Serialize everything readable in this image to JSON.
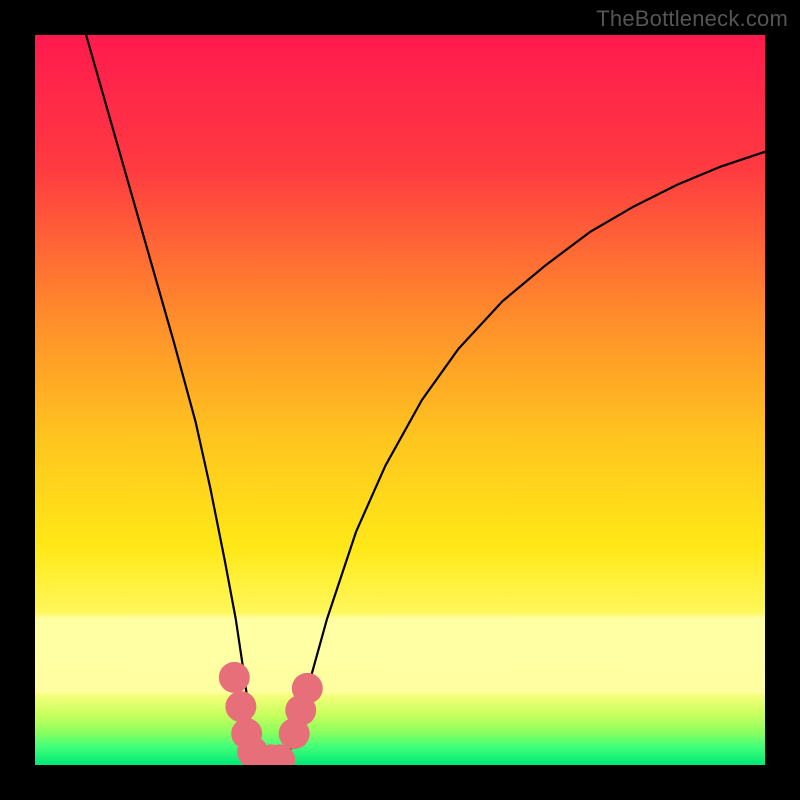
{
  "watermark": {
    "text": "TheBottleneck.com"
  },
  "chart_data": {
    "type": "line",
    "title": "",
    "xlabel": "",
    "ylabel": "",
    "xlim": [
      0,
      100
    ],
    "ylim": [
      0,
      100
    ],
    "grid": false,
    "legend": false,
    "background_gradient": {
      "stops": [
        {
          "pos": 0.0,
          "color": "#ff1a4e"
        },
        {
          "pos": 0.18,
          "color": "#ff3a41"
        },
        {
          "pos": 0.38,
          "color": "#ff8a2c"
        },
        {
          "pos": 0.55,
          "color": "#ffc41f"
        },
        {
          "pos": 0.7,
          "color": "#ffe817"
        },
        {
          "pos": 0.79,
          "color": "#fff75a"
        },
        {
          "pos": 0.8,
          "color": "#ffffa4"
        },
        {
          "pos": 0.9,
          "color": "#ffffa2"
        },
        {
          "pos": 0.905,
          "color": "#f3ff7a"
        },
        {
          "pos": 0.93,
          "color": "#caff5e"
        },
        {
          "pos": 0.955,
          "color": "#8cff5f"
        },
        {
          "pos": 0.975,
          "color": "#42ff79"
        },
        {
          "pos": 1.0,
          "color": "#00e876"
        }
      ]
    },
    "series": [
      {
        "name": "bottleneck-curve",
        "color": "#000000",
        "x": [
          7.0,
          10.0,
          13.0,
          16.0,
          19.0,
          22.0,
          24.0,
          26.0,
          27.5,
          28.7,
          29.6,
          30.3,
          32.5,
          34.5,
          35.8,
          37.5,
          40.0,
          44.0,
          48.0,
          53.0,
          58.0,
          64.0,
          70.0,
          76.0,
          82.0,
          88.0,
          94.0,
          100.0
        ],
        "y": [
          100.0,
          89.5,
          79.0,
          68.5,
          58.0,
          47.0,
          38.0,
          28.0,
          20.0,
          12.0,
          5.0,
          0.5,
          0.5,
          0.5,
          5.0,
          11.0,
          20.0,
          32.0,
          41.0,
          50.0,
          57.0,
          63.5,
          68.5,
          73.0,
          76.5,
          79.5,
          82.0,
          84.0
        ]
      }
    ],
    "markers": [
      {
        "x": 27.3,
        "y": 12.0,
        "color": "#e76f7a",
        "r": 1.3
      },
      {
        "x": 28.2,
        "y": 8.0,
        "color": "#e76f7a",
        "r": 1.3
      },
      {
        "x": 29.0,
        "y": 4.3,
        "color": "#e76f7a",
        "r": 1.3
      },
      {
        "x": 29.8,
        "y": 1.8,
        "color": "#e76f7a",
        "r": 1.3
      },
      {
        "x": 31.0,
        "y": 0.7,
        "color": "#e76f7a",
        "r": 1.3
      },
      {
        "x": 32.3,
        "y": 0.7,
        "color": "#e76f7a",
        "r": 1.3
      },
      {
        "x": 33.5,
        "y": 0.7,
        "color": "#e76f7a",
        "r": 1.3
      },
      {
        "x": 35.5,
        "y": 4.3,
        "color": "#e76f7a",
        "r": 1.3
      },
      {
        "x": 36.4,
        "y": 7.5,
        "color": "#e76f7a",
        "r": 1.3
      },
      {
        "x": 37.3,
        "y": 10.5,
        "color": "#e76f7a",
        "r": 1.3
      }
    ]
  }
}
